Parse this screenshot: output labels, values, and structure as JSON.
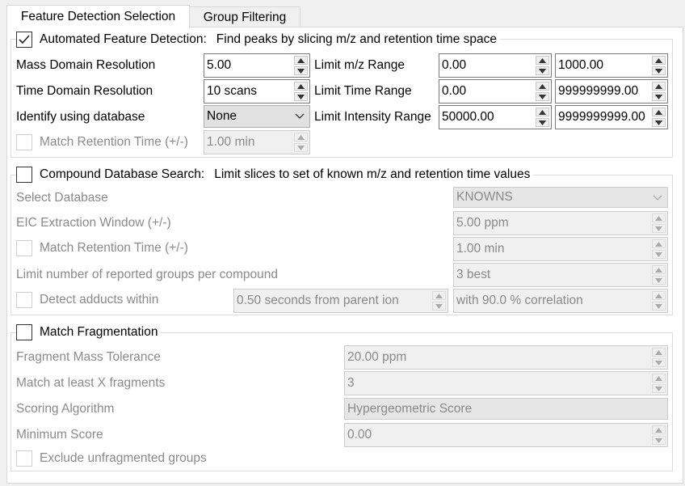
{
  "tabs": [
    {
      "label": "Feature Detection Selection"
    },
    {
      "label": "Group Filtering"
    }
  ],
  "auto": {
    "checkbox_label": "Automated Feature Detection:",
    "description": "Find peaks by slicing m/z and retention time space",
    "checked": true,
    "mass_res_label": "Mass Domain Resolution",
    "mass_res_value": "5.00",
    "time_res_label": "Time Domain Resolution",
    "time_res_value": "10 scans",
    "identify_label": "Identify using database",
    "identify_value": "None",
    "match_rt_label": "Match Retention Time (+/-)",
    "match_rt_value": "1.00 min",
    "mz_range_label": "Limit m/z Range",
    "mz_min": "0.00",
    "mz_max": "1000.00",
    "time_range_label": "Limit Time Range",
    "time_min": "0.00",
    "time_max": "999999999.00",
    "intensity_range_label": "Limit Intensity Range",
    "intensity_min": "50000.00",
    "intensity_max": "9999999999.00"
  },
  "compound": {
    "checkbox_label": "Compound Database Search:",
    "description": "Limit slices to set of known m/z and retention time values",
    "checked": false,
    "select_db_label": "Select Database",
    "select_db_value": "KNOWNS",
    "eic_label": "EIC Extraction Window (+/-)",
    "eic_value": "5.00 ppm",
    "match_rt_label": "Match Retention Time (+/-)",
    "match_rt_value": "1.00 min",
    "limit_groups_label": "Limit number of reported groups per compound",
    "limit_groups_value": "3 best",
    "adducts_label": "Detect adducts within",
    "adducts_seconds": "0.50 seconds from parent ion",
    "adducts_corr": "with 90.0 % correlation"
  },
  "frag": {
    "checkbox_label": "Match Fragmentation",
    "checked": false,
    "tolerance_label": "Fragment Mass Tolerance",
    "tolerance_value": "20.00 ppm",
    "min_frag_label": "Match at least X fragments",
    "min_frag_value": "3",
    "scoring_label": "Scoring Algorithm",
    "scoring_value": "Hypergeometric Score",
    "min_score_label": "Minimum Score",
    "min_score_value": "0.00",
    "exclude_label": "Exclude unfragmented groups"
  }
}
